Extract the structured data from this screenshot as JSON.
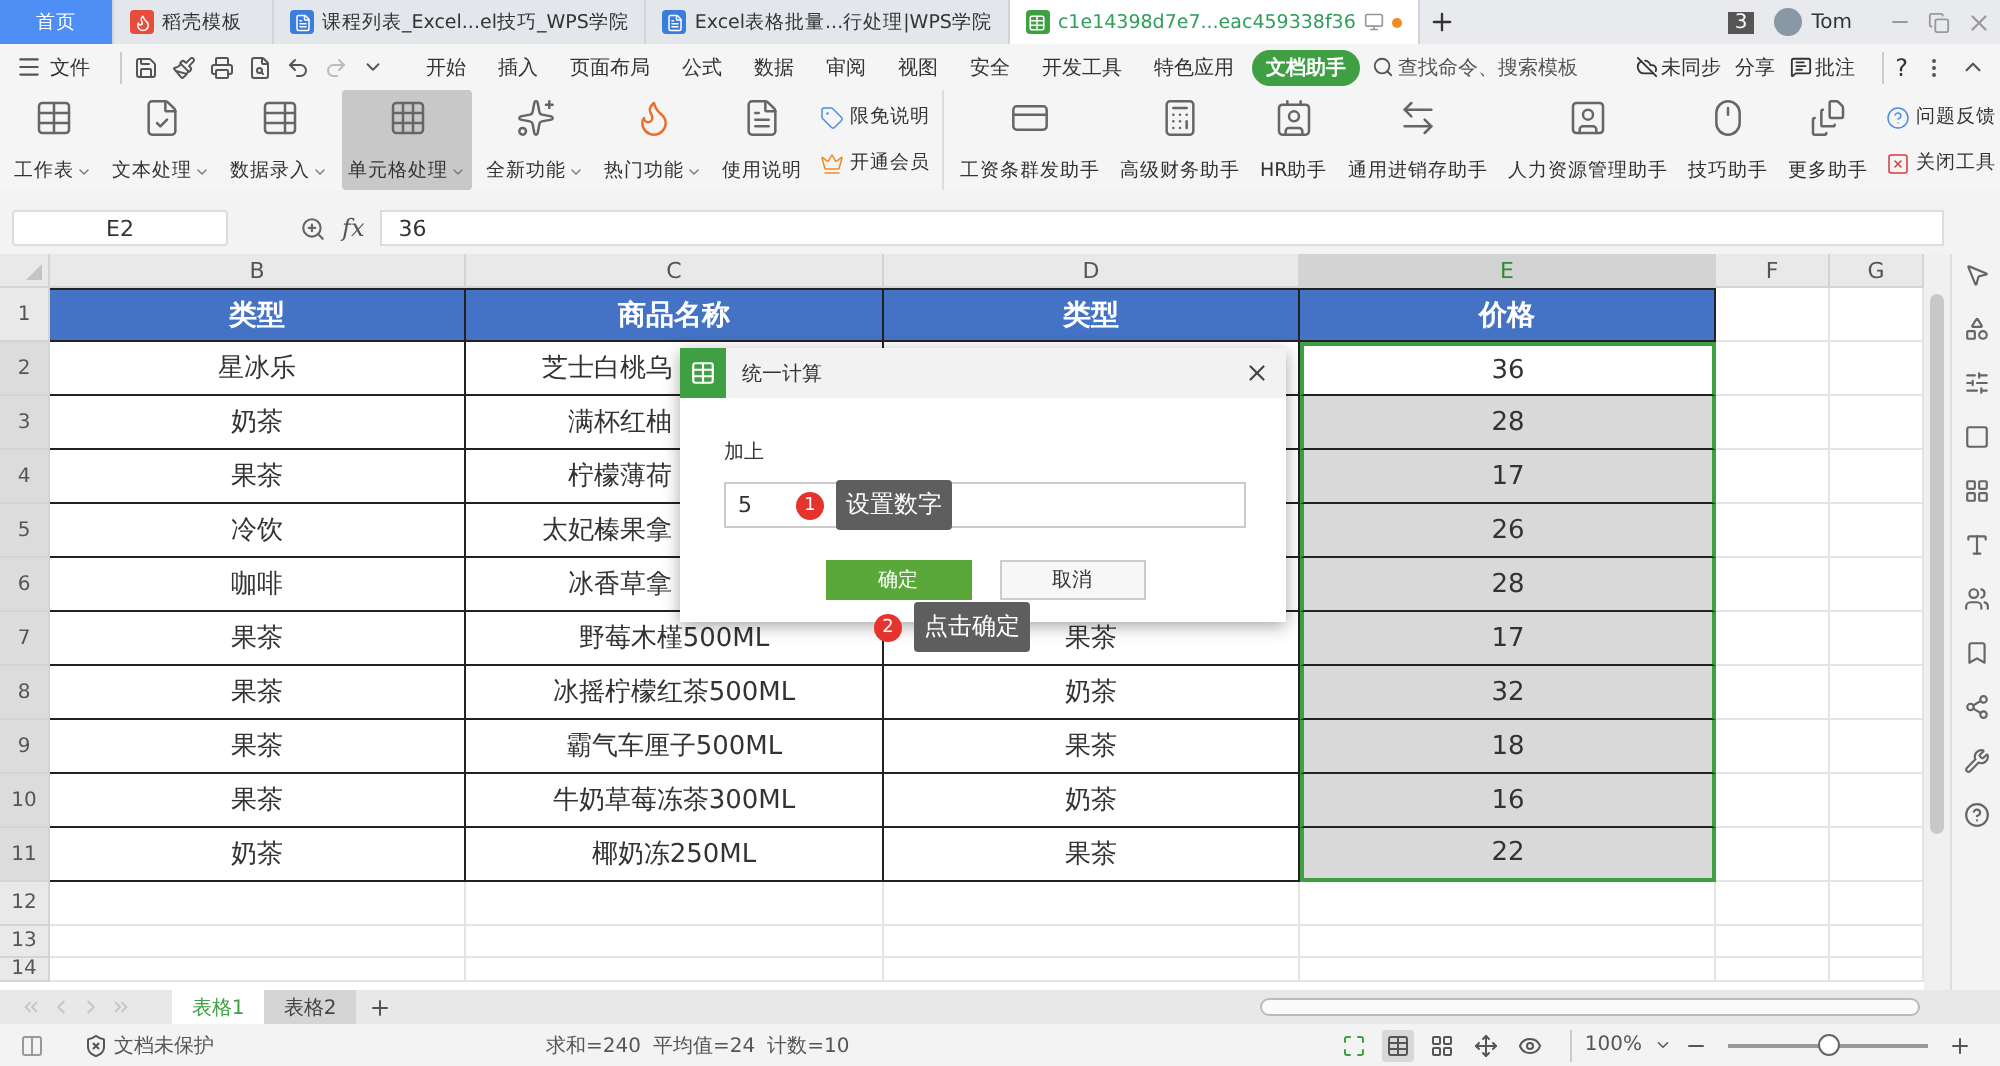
{
  "tabs": [
    {
      "label": "首页",
      "kind": "home",
      "selected": false
    },
    {
      "label": "稻壳模板",
      "kind": "docer",
      "selected": false
    },
    {
      "label": "课程列表_Excel...el技巧_WPS学院",
      "kind": "web",
      "selected": false
    },
    {
      "label": "Excel表格批量...行处理|WPS学院",
      "kind": "web",
      "selected": false
    },
    {
      "label": "c1e14398d7e7...eac459338f36",
      "kind": "sheet",
      "selected": true
    }
  ],
  "window_count": "3",
  "user": "Tom",
  "menu": {
    "file": "文件",
    "items": [
      {
        "label": "开始",
        "selected": false
      },
      {
        "label": "插入",
        "selected": false
      },
      {
        "label": "页面布局",
        "selected": false
      },
      {
        "label": "公式",
        "selected": false
      },
      {
        "label": "数据",
        "selected": false
      },
      {
        "label": "审阅",
        "selected": false
      },
      {
        "label": "视图",
        "selected": false
      },
      {
        "label": "安全",
        "selected": false
      },
      {
        "label": "开发工具",
        "selected": false
      },
      {
        "label": "特色应用",
        "selected": false
      },
      {
        "label": "文档助手",
        "selected": true
      }
    ],
    "search": "查找命令、搜索模板",
    "sync": "未同步",
    "share": "分享",
    "comment": "批注",
    "help": "?"
  },
  "ribbon": {
    "tools": [
      {
        "label": "工作表",
        "kind": "sheet",
        "dropdown": true,
        "selected": false
      },
      {
        "label": "文本处理",
        "kind": "text",
        "dropdown": true,
        "selected": false
      },
      {
        "label": "数据录入",
        "kind": "entry",
        "dropdown": true,
        "selected": false
      },
      {
        "label": "单元格处理",
        "kind": "cell",
        "dropdown": true,
        "selected": true
      },
      {
        "label": "全新功能",
        "kind": "new",
        "dropdown": true,
        "selected": false
      },
      {
        "label": "热门功能",
        "kind": "hot",
        "dropdown": true,
        "selected": false
      },
      {
        "label": "使用说明",
        "kind": "manual",
        "dropdown": false,
        "selected": false
      }
    ],
    "side": [
      {
        "label": "限免说明",
        "kind": "tag"
      },
      {
        "label": "开通会员",
        "kind": "crown"
      }
    ],
    "helpers": [
      {
        "label": "工资条群发助手",
        "kind": "salary"
      },
      {
        "label": "高级财务助手",
        "kind": "finance"
      },
      {
        "label": "HR助手",
        "kind": "hr"
      },
      {
        "label": "通用进销存助手",
        "kind": "stock"
      },
      {
        "label": "人力资源管理助手",
        "kind": "people"
      },
      {
        "label": "技巧助手",
        "kind": "tips"
      },
      {
        "label": "更多助手",
        "kind": "more"
      }
    ],
    "extra": [
      {
        "label": "问题反馈",
        "kind": "help"
      },
      {
        "label": "关闭工具",
        "kind": "close"
      }
    ]
  },
  "formula": {
    "cell": "E2",
    "fx": "fx",
    "value": "36"
  },
  "columns": [
    {
      "label": "B",
      "selected": false
    },
    {
      "label": "C",
      "selected": false
    },
    {
      "label": "D",
      "selected": false
    },
    {
      "label": "E",
      "selected": true
    },
    {
      "label": "F",
      "selected": false
    },
    {
      "label": "G",
      "selected": false
    }
  ],
  "table": {
    "header_num": "1",
    "header": [
      "类型",
      "商品名称",
      "类型",
      "价格"
    ],
    "rows": [
      {
        "num": "2",
        "b": "星冰乐",
        "c": "芝士白桃乌",
        "e": "36",
        "under_dialog": true
      },
      {
        "num": "3",
        "b": "奶茶",
        "c": "满杯红柚",
        "e": "28",
        "under_dialog": true
      },
      {
        "num": "4",
        "b": "果茶",
        "c": "柠檬薄荷",
        "e": "17",
        "under_dialog": true
      },
      {
        "num": "5",
        "b": "冷饮",
        "c": "太妃榛果拿",
        "e": "26",
        "under_dialog": true
      },
      {
        "num": "6",
        "b": "咖啡",
        "c": "冰香草拿",
        "e": "28",
        "under_dialog": true
      },
      {
        "num": "7",
        "b": "果茶",
        "c": "野莓木槿500ML",
        "d": "果茶",
        "e": "17",
        "under_dialog": false
      },
      {
        "num": "8",
        "b": "果茶",
        "c": "冰摇柠檬红茶500ML",
        "d": "奶茶",
        "e": "32",
        "under_dialog": false
      },
      {
        "num": "9",
        "b": "果茶",
        "c": "霸气车厘子500ML",
        "d": "果茶",
        "e": "18",
        "under_dialog": false
      },
      {
        "num": "10",
        "b": "果茶",
        "c": "牛奶草莓冻茶300ML",
        "d": "奶茶",
        "e": "16",
        "under_dialog": false
      },
      {
        "num": "11",
        "b": "奶茶",
        "c": "椰奶冻250ML",
        "d": "果茶",
        "e": "22",
        "under_dialog": false
      }
    ],
    "empty_rows": [
      "12",
      "13",
      "14"
    ]
  },
  "dialog": {
    "title": "统一计算",
    "label": "加上",
    "value": "5",
    "ok": "确定",
    "cancel": "取消"
  },
  "callouts": [
    {
      "number": "1",
      "text": "设置数字"
    },
    {
      "number": "2",
      "text": "点击确定"
    }
  ],
  "sheets": [
    {
      "label": "表格1",
      "selected": true
    },
    {
      "label": "表格2",
      "selected": false
    }
  ],
  "status": {
    "protect": "文档未保护",
    "sum": "求和=240",
    "avg": "平均值=24",
    "count": "计数=10",
    "zoom": "100%",
    "zoom_slider": {
      "level": 0.5
    }
  }
}
